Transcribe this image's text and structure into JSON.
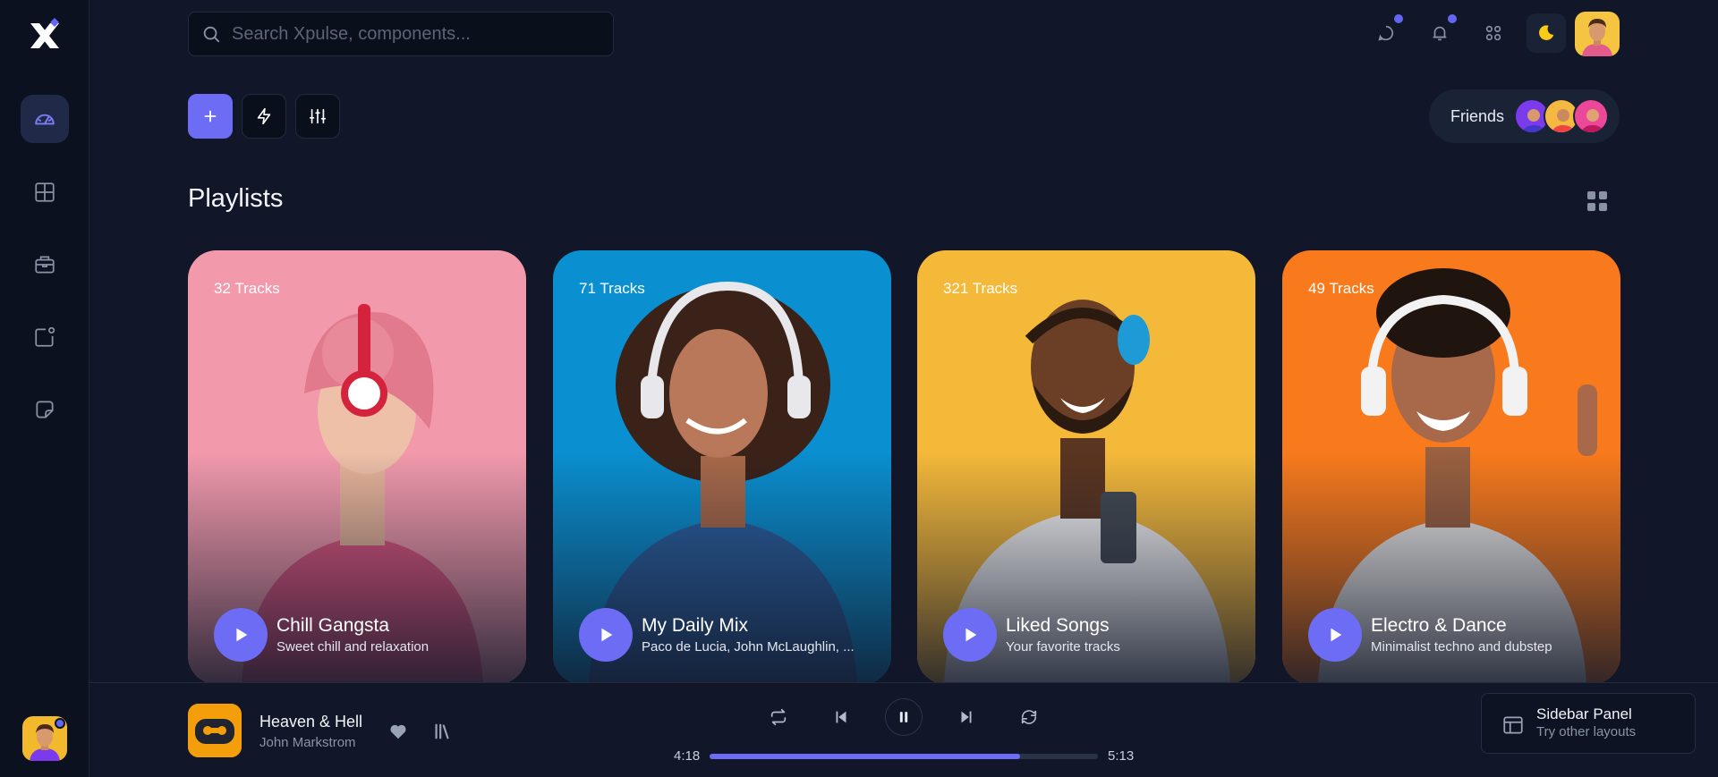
{
  "search": {
    "placeholder": "Search Xpulse, components..."
  },
  "friends": {
    "label": "Friends"
  },
  "section": {
    "title": "Playlists"
  },
  "playlists": [
    {
      "tracks": "32 Tracks",
      "title": "Chill Gangsta",
      "subtitle": "Sweet chill and relaxation"
    },
    {
      "tracks": "71 Tracks",
      "title": "My Daily Mix",
      "subtitle": "Paco de Lucia, John McLaughlin, ..."
    },
    {
      "tracks": "321 Tracks",
      "title": "Liked Songs",
      "subtitle": "Your favorite tracks"
    },
    {
      "tracks": "49 Tracks",
      "title": "Electro & Dance",
      "subtitle": "Minimalist techno and dubstep"
    }
  ],
  "player": {
    "song_title": "Heaven & Hell",
    "artist": "John Markstrom",
    "elapsed": "4:18",
    "duration": "5:13",
    "progress": 0.8
  },
  "panel": {
    "title": "Sidebar Panel",
    "subtitle": "Try other layouts"
  },
  "colors": {
    "accent": "#6d6cf4",
    "background": "#111728",
    "sidebar": "#0c1120"
  },
  "icons": {
    "sidebar": [
      "dashboard-icon",
      "grid-icon",
      "briefcase-icon",
      "notification-square-icon",
      "sticker-icon"
    ],
    "top": [
      "chat-icon",
      "bell-icon",
      "apps-icon",
      "moon-icon"
    ],
    "actions": [
      "plus-icon",
      "lightning-icon",
      "sliders-icon"
    ],
    "player": [
      "heart-icon",
      "library-icon",
      "repeat-icon",
      "previous-icon",
      "pause-icon",
      "next-icon",
      "shuffle-icon",
      "layout-icon"
    ]
  }
}
